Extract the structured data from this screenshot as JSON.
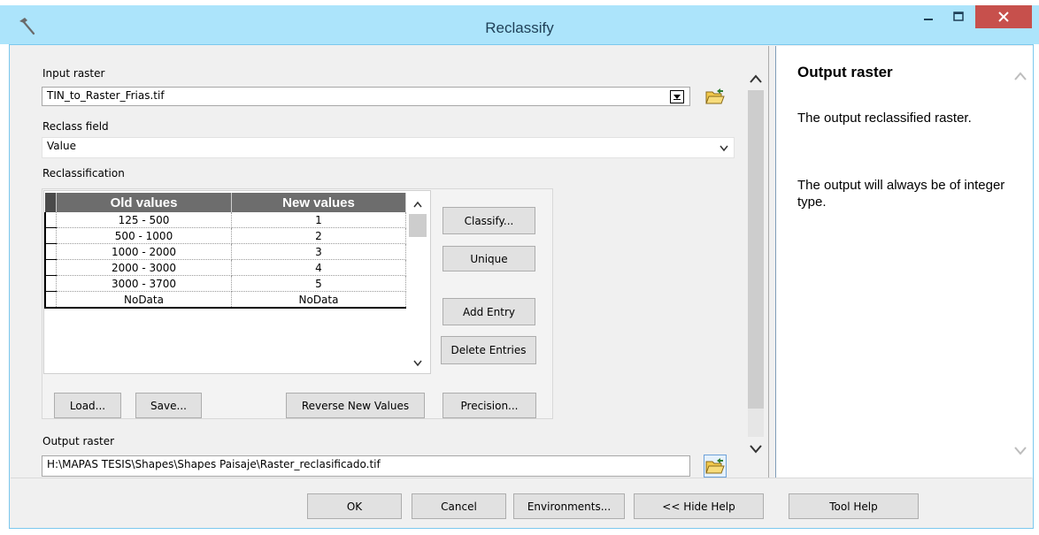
{
  "window": {
    "title": "Reclassify"
  },
  "colors": {
    "titlebar": "#ace4fb",
    "close_button": "#c7504c",
    "table_header": "#6d6d6d"
  },
  "input_raster": {
    "label": "Input raster",
    "value": "TIN_to_Raster_Frias.tif"
  },
  "reclass_field": {
    "label": "Reclass field",
    "value": "Value"
  },
  "reclassification": {
    "label": "Reclassification",
    "columns": [
      "Old values",
      "New values"
    ],
    "rows": [
      {
        "old": "125 -  500",
        "new": "1"
      },
      {
        "old": "500 -  1000",
        "new": "2"
      },
      {
        "old": "1000 -  2000",
        "new": "3"
      },
      {
        "old": "2000 -  3000",
        "new": "4"
      },
      {
        "old": "3000 - 3700",
        "new": "5"
      },
      {
        "old": "NoData",
        "new": "NoData"
      }
    ],
    "buttons": {
      "classify": "Classify...",
      "unique": "Unique",
      "add_entry": "Add Entry",
      "delete_entries": "Delete Entries",
      "load": "Load...",
      "save": "Save...",
      "reverse": "Reverse New Values",
      "precision": "Precision..."
    }
  },
  "output_raster": {
    "label": "Output raster",
    "value": "H:\\MAPAS TESIS\\Shapes\\Shapes Paisaje\\Raster_reclasificado.tif"
  },
  "footer": {
    "ok": "OK",
    "cancel": "Cancel",
    "environments": "Environments...",
    "hide_help": "<< Hide Help",
    "tool_help": "Tool Help"
  },
  "help": {
    "title": "Output raster",
    "paragraph1": "The output reclassified raster.",
    "paragraph2": "The output will always be of integer type."
  }
}
